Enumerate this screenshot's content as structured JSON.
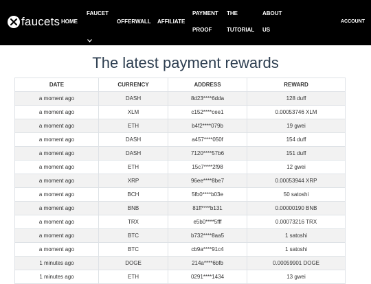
{
  "brand": {
    "name": "faucets"
  },
  "nav": {
    "home": "HOME",
    "faucet_line1": "FAUCET",
    "offerwall": "OFFERWALL",
    "affiliate": "AFFILIATE",
    "payment_proof_line1": "PAYMENT",
    "payment_proof_line2": "PROOF",
    "tutorial_line1": "THE",
    "tutorial_line2": "TUTORIAL",
    "about_line1": "ABOUT",
    "about_line2": "US",
    "account": "ACCOUNT"
  },
  "page": {
    "title": "The latest payment rewards"
  },
  "table": {
    "headers": [
      "DATE",
      "CURRENCY",
      "ADDRESS",
      "REWARD"
    ],
    "rows": [
      [
        "a moment ago",
        "DASH",
        "8d23****6dda",
        "128 duff"
      ],
      [
        "a moment ago",
        "XLM",
        "c152****cee1",
        "0.00053746 XLM"
      ],
      [
        "a moment ago",
        "ETH",
        "b4f2****079b",
        "19 gwei"
      ],
      [
        "a moment ago",
        "DASH",
        "a457****050f",
        "154 duff"
      ],
      [
        "a moment ago",
        "DASH",
        "7120****57b6",
        "151 duff"
      ],
      [
        "a moment ago",
        "ETH",
        "15c7****2f98",
        "12 gwei"
      ],
      [
        "a moment ago",
        "XRP",
        "96ee****8be7",
        "0.00053944 XRP"
      ],
      [
        "a moment ago",
        "BCH",
        "5fb0****b03e",
        "50 satoshi"
      ],
      [
        "a moment ago",
        "BNB",
        "81ff****b131",
        "0.00000190 BNB"
      ],
      [
        "a moment ago",
        "TRX",
        "e5b0****5fff",
        "0.00073216 TRX"
      ],
      [
        "a moment ago",
        "BTC",
        "b732****8aa5",
        "1 satoshi"
      ],
      [
        "a moment ago",
        "BTC",
        "cb9a****91c4",
        "1 satoshi"
      ],
      [
        "1 minutes ago",
        "DOGE",
        "214a****6bfb",
        "0.00059901 DOGE"
      ],
      [
        "1 minutes ago",
        "ETH",
        "0291****1434",
        "13 gwei"
      ]
    ]
  }
}
